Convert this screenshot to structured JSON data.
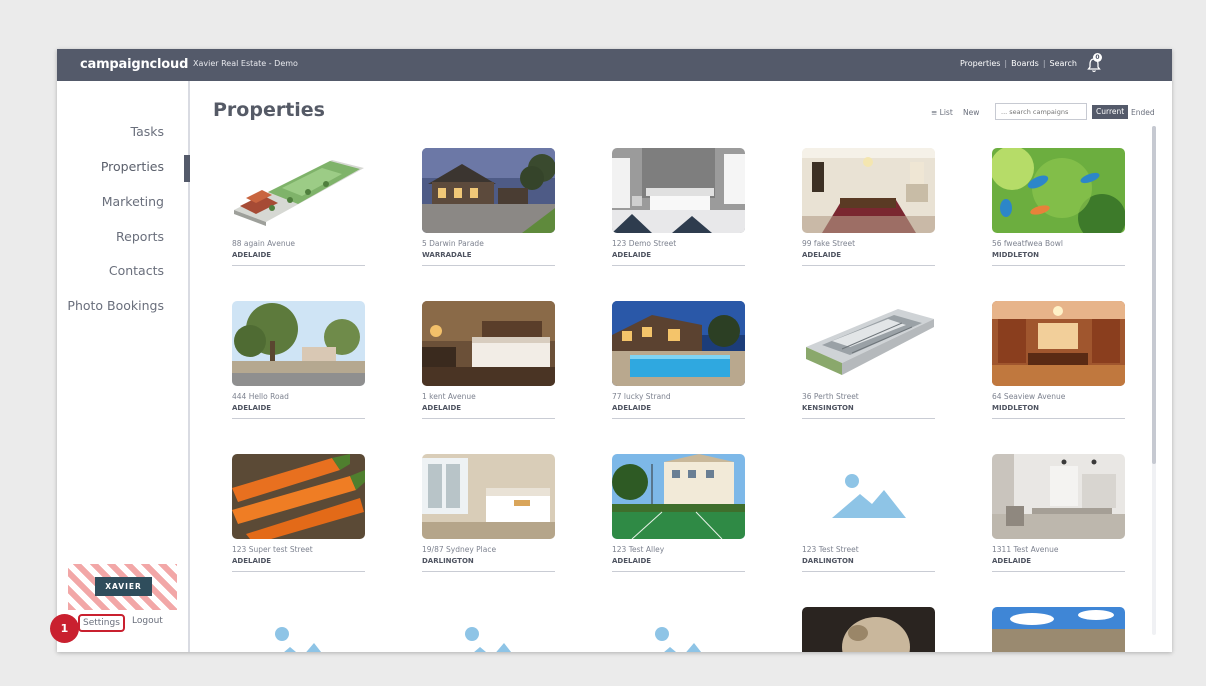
{
  "header": {
    "brand": "campaigncloud",
    "account": "Xavier Real Estate - Demo",
    "links": [
      "Properties",
      "Boards",
      "Search"
    ],
    "notification_count": "0"
  },
  "sidebar": {
    "items": [
      {
        "label": "Tasks"
      },
      {
        "label": "Properties",
        "active": true
      },
      {
        "label": "Marketing"
      },
      {
        "label": "Reports"
      },
      {
        "label": "Contacts"
      },
      {
        "label": "Photo Bookings"
      }
    ],
    "user_badge": "XAVIER",
    "settings": "Settings",
    "logout": "Logout"
  },
  "annotation": {
    "step": "1"
  },
  "main": {
    "title": "Properties",
    "list_toggle": "List",
    "new": "New",
    "search_placeholder": "... search campaigns",
    "filter_current": "Current",
    "filter_ended": "Ended"
  },
  "properties": [
    {
      "street": "88 again Avenue",
      "suburb": "ADELAIDE",
      "image": "aerial-site-plan"
    },
    {
      "street": "5 Darwin Parade",
      "suburb": "WARRADALE",
      "image": "house-exterior-dusk"
    },
    {
      "street": "123 Demo Street",
      "suburb": "ADELAIDE",
      "image": "white-bedroom"
    },
    {
      "street": "99 fake Street",
      "suburb": "ADELAIDE",
      "image": "dining-room"
    },
    {
      "street": "56 fweatfwea Bowl",
      "suburb": "MIDDLETON",
      "image": "kingfisher-birds"
    },
    {
      "street": "444 Hello Road",
      "suburb": "ADELAIDE",
      "image": "street-trees"
    },
    {
      "street": "1 kent Avenue",
      "suburb": "ADELAIDE",
      "image": "hotel-bedroom"
    },
    {
      "street": "77 lucky Strand",
      "suburb": "ADELAIDE",
      "image": "pool-night"
    },
    {
      "street": "36 Perth Street",
      "suburb": "KENSINGTON",
      "image": "aerial-building-render"
    },
    {
      "street": "64 Seaview Avenue",
      "suburb": "MIDDLETON",
      "image": "warm-interior"
    },
    {
      "street": "123 Super test Street",
      "suburb": "ADELAIDE",
      "image": "carrots"
    },
    {
      "street": "19/87 Sydney Place",
      "suburb": "DARLINGTON",
      "image": "bright-bedroom"
    },
    {
      "street": "123 Test Alley",
      "suburb": "ADELAIDE",
      "image": "tennis-court-house"
    },
    {
      "street": "123 Test Street",
      "suburb": "DARLINGTON",
      "image": "image-placeholder"
    },
    {
      "street": "1311 Test Avenue",
      "suburb": "ADELAIDE",
      "image": "kitchen"
    },
    {
      "street": "",
      "suburb": "",
      "image": "image-placeholder"
    },
    {
      "street": "",
      "suburb": "",
      "image": "image-placeholder"
    },
    {
      "street": "",
      "suburb": "",
      "image": "image-placeholder"
    },
    {
      "street": "",
      "suburb": "",
      "image": "dog-photo"
    },
    {
      "street": "",
      "suburb": "",
      "image": "sky-landscape"
    }
  ],
  "colors": {
    "topbar": "#545a6a",
    "accent_highlight": "#c9202f",
    "placeholder_icon": "#8ec4e6"
  }
}
